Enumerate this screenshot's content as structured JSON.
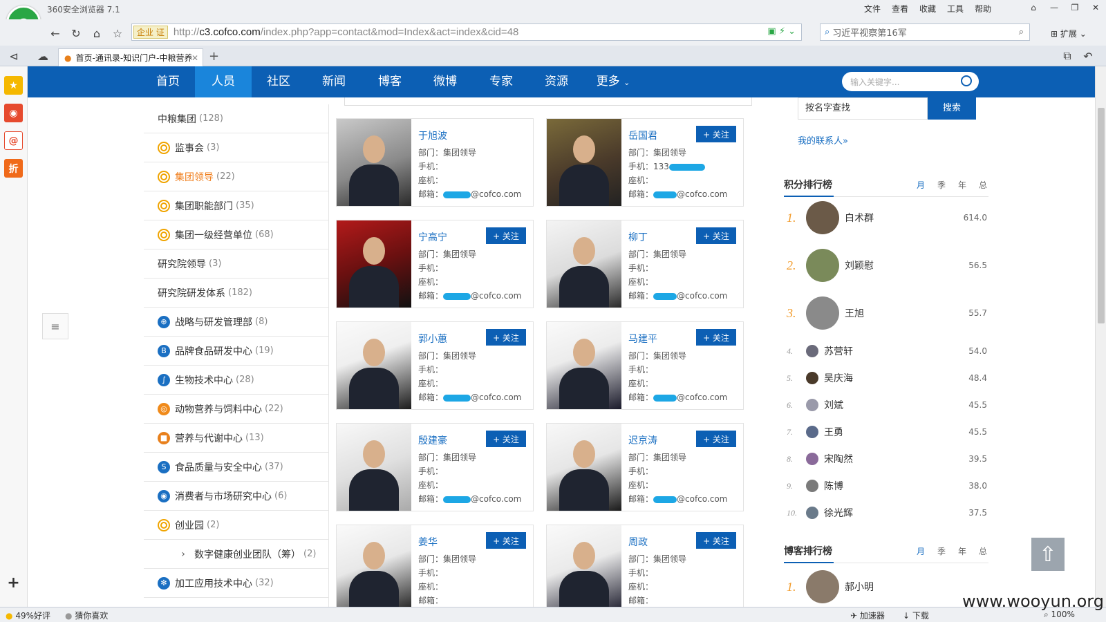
{
  "browser": {
    "title": "360安全浏览器 7.1",
    "menu": [
      "文件",
      "查看",
      "收藏",
      "工具",
      "帮助"
    ],
    "url_host": "c3.cofco.com",
    "url_prefix": "http://",
    "url_path": "/index.php?app=contact&mod=Index&act=index&cid=48",
    "enterprise_badge": "企业 证",
    "search_placeholder": "习近平视察第16军",
    "extensions_label": "扩展",
    "tab_title": "首页-通讯录-知识门户-中粮营养",
    "status_rating": "49%好评",
    "status_like": "猜你喜欢",
    "status_accel": "加速器",
    "status_download": "下载",
    "status_zoom": "100%"
  },
  "nav": {
    "items": [
      "首页",
      "人员",
      "社区",
      "新闻",
      "博客",
      "微博",
      "专家",
      "资源",
      "更多"
    ],
    "active_index": 1,
    "search_placeholder": "输入关键字..."
  },
  "org": [
    {
      "label": "中粮集团",
      "count": "(128)",
      "icon": "none"
    },
    {
      "label": "监事会",
      "count": "(3)",
      "icon": "ring-icon"
    },
    {
      "label": "集团领导",
      "count": "(22)",
      "icon": "ring-icon",
      "active": true
    },
    {
      "label": "集团职能部门",
      "count": "(35)",
      "icon": "ring-icon"
    },
    {
      "label": "集团一级经营单位",
      "count": "(68)",
      "icon": "ring-icon"
    },
    {
      "label": "研究院领导",
      "count": "(3)",
      "icon": "none"
    },
    {
      "label": "研究院研发体系",
      "count": "(182)",
      "icon": "none"
    },
    {
      "label": "战略与研发管理部",
      "count": "(8)",
      "icon": "target-icon"
    },
    {
      "label": "品牌食品研发中心",
      "count": "(19)",
      "icon": "brand-icon"
    },
    {
      "label": "生物技术中心",
      "count": "(28)",
      "icon": "dna-icon"
    },
    {
      "label": "动物营养与饲料中心",
      "count": "(22)",
      "icon": "animal-icon"
    },
    {
      "label": "营养与代谢中心",
      "count": "(13)",
      "icon": "cube-icon"
    },
    {
      "label": "食品质量与安全中心",
      "count": "(37)",
      "icon": "shield-icon"
    },
    {
      "label": "消费者与市场研究中心",
      "count": "(6)",
      "icon": "globe-icon"
    },
    {
      "label": "创业园",
      "count": "(2)",
      "icon": "ring-icon"
    },
    {
      "label": "数字健康创业团队（筹）",
      "count": "(2)",
      "icon": "chevron-right-icon",
      "sub": true
    },
    {
      "label": "加工应用技术中心",
      "count": "(32)",
      "icon": "gear-icon"
    }
  ],
  "card_labels": {
    "dept": "部门：",
    "mobile": "手机：",
    "phone": "座机：",
    "email": "邮箱：",
    "follow": "+ 关注"
  },
  "people": [
    {
      "name": "于旭波",
      "dept": "集团领导",
      "mobile": "",
      "phone": "",
      "email_domain": "@cofco.com",
      "follow": false
    },
    {
      "name": "岳国君",
      "dept": "集团领导",
      "mobile": "133",
      "phone": "",
      "email_domain": "@cofco.com",
      "follow": true
    },
    {
      "name": "宁高宁",
      "dept": "集团领导",
      "mobile": "",
      "phone": "",
      "email_domain": "@cofco.com",
      "follow": true
    },
    {
      "name": "柳丁",
      "dept": "集团领导",
      "mobile": "",
      "phone": "",
      "email_domain": "@cofco.com",
      "follow": true
    },
    {
      "name": "郭小蕙",
      "dept": "集团领导",
      "mobile": "",
      "phone": "",
      "email_domain": "@cofco.com",
      "follow": true
    },
    {
      "name": "马建平",
      "dept": "集团领导",
      "mobile": "",
      "phone": "",
      "email_domain": "@cofco.com",
      "follow": true
    },
    {
      "name": "殷建豪",
      "dept": "集团领导",
      "mobile": "",
      "phone": "",
      "email_domain": "@cofco.com",
      "follow": true
    },
    {
      "name": "迟京涛",
      "dept": "集团领导",
      "mobile": "",
      "phone": "",
      "email_domain": "@cofco.com",
      "follow": true
    },
    {
      "name": "姜华",
      "dept": "集团领导",
      "mobile": "",
      "phone": "",
      "email_domain": "",
      "follow": true
    },
    {
      "name": "周政",
      "dept": "集团领导",
      "mobile": "",
      "phone": "",
      "email_domain": "",
      "follow": true
    }
  ],
  "right": {
    "search_value": "按名字查找",
    "search_button": "搜索",
    "my_contacts": "我的联系人»",
    "points_title": "积分排行榜",
    "blog_title": "博客排行榜",
    "period_tabs": [
      "月",
      "季",
      "年",
      "总"
    ],
    "points": [
      {
        "rank": "1.",
        "name": "白术群",
        "score": "614.0"
      },
      {
        "rank": "2.",
        "name": "刘颖慰",
        "score": "56.5"
      },
      {
        "rank": "3.",
        "name": "王旭",
        "score": "55.7"
      },
      {
        "rank": "4.",
        "name": "苏营轩",
        "score": "54.0"
      },
      {
        "rank": "5.",
        "name": "吴庆海",
        "score": "48.4"
      },
      {
        "rank": "6.",
        "name": "刘斌",
        "score": "45.5"
      },
      {
        "rank": "7.",
        "name": "王勇",
        "score": "45.5"
      },
      {
        "rank": "8.",
        "name": "宋陶然",
        "score": "39.5"
      },
      {
        "rank": "9.",
        "name": "陈博",
        "score": "38.0"
      },
      {
        "rank": "10.",
        "name": "徐光辉",
        "score": "37.5"
      }
    ],
    "blog": [
      {
        "rank": "1.",
        "name": "郝小明",
        "score": ""
      }
    ]
  },
  "watermark": "www.wooyun.org"
}
